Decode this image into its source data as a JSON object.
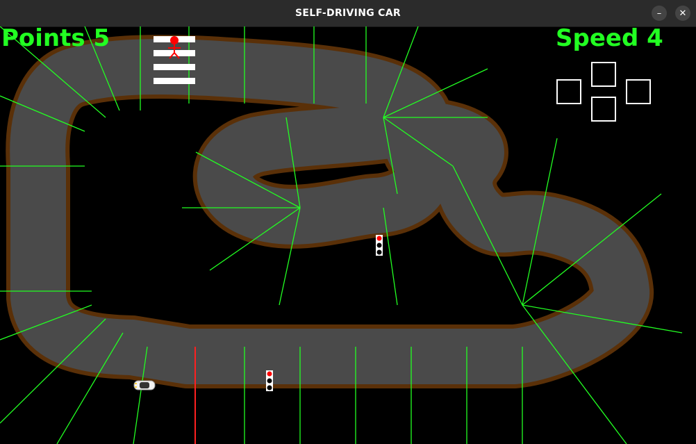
{
  "window": {
    "title": "SELF-DRIVING CAR",
    "minimize_icon": "minimize-icon",
    "close_icon": "close-icon",
    "minimize_glyph": "–",
    "close_glyph": "✕"
  },
  "hud": {
    "points_label": "Points",
    "points_value": "5",
    "speed_label": "Speed",
    "speed_value": "4"
  },
  "controls": {
    "keys": [
      "up",
      "left",
      "down",
      "right"
    ],
    "border_color": "#ffffff"
  },
  "colors": {
    "background": "#000000",
    "track": "#4a4a4a",
    "track_edge": "#5a3008",
    "sensor_lines": "#22ff22",
    "finish_line": "#ff2020",
    "hud_text": "#22ff22",
    "pedestrian": "#ff0000"
  },
  "traffic_lights": [
    {
      "state": "red"
    },
    {
      "state": "red"
    }
  ]
}
